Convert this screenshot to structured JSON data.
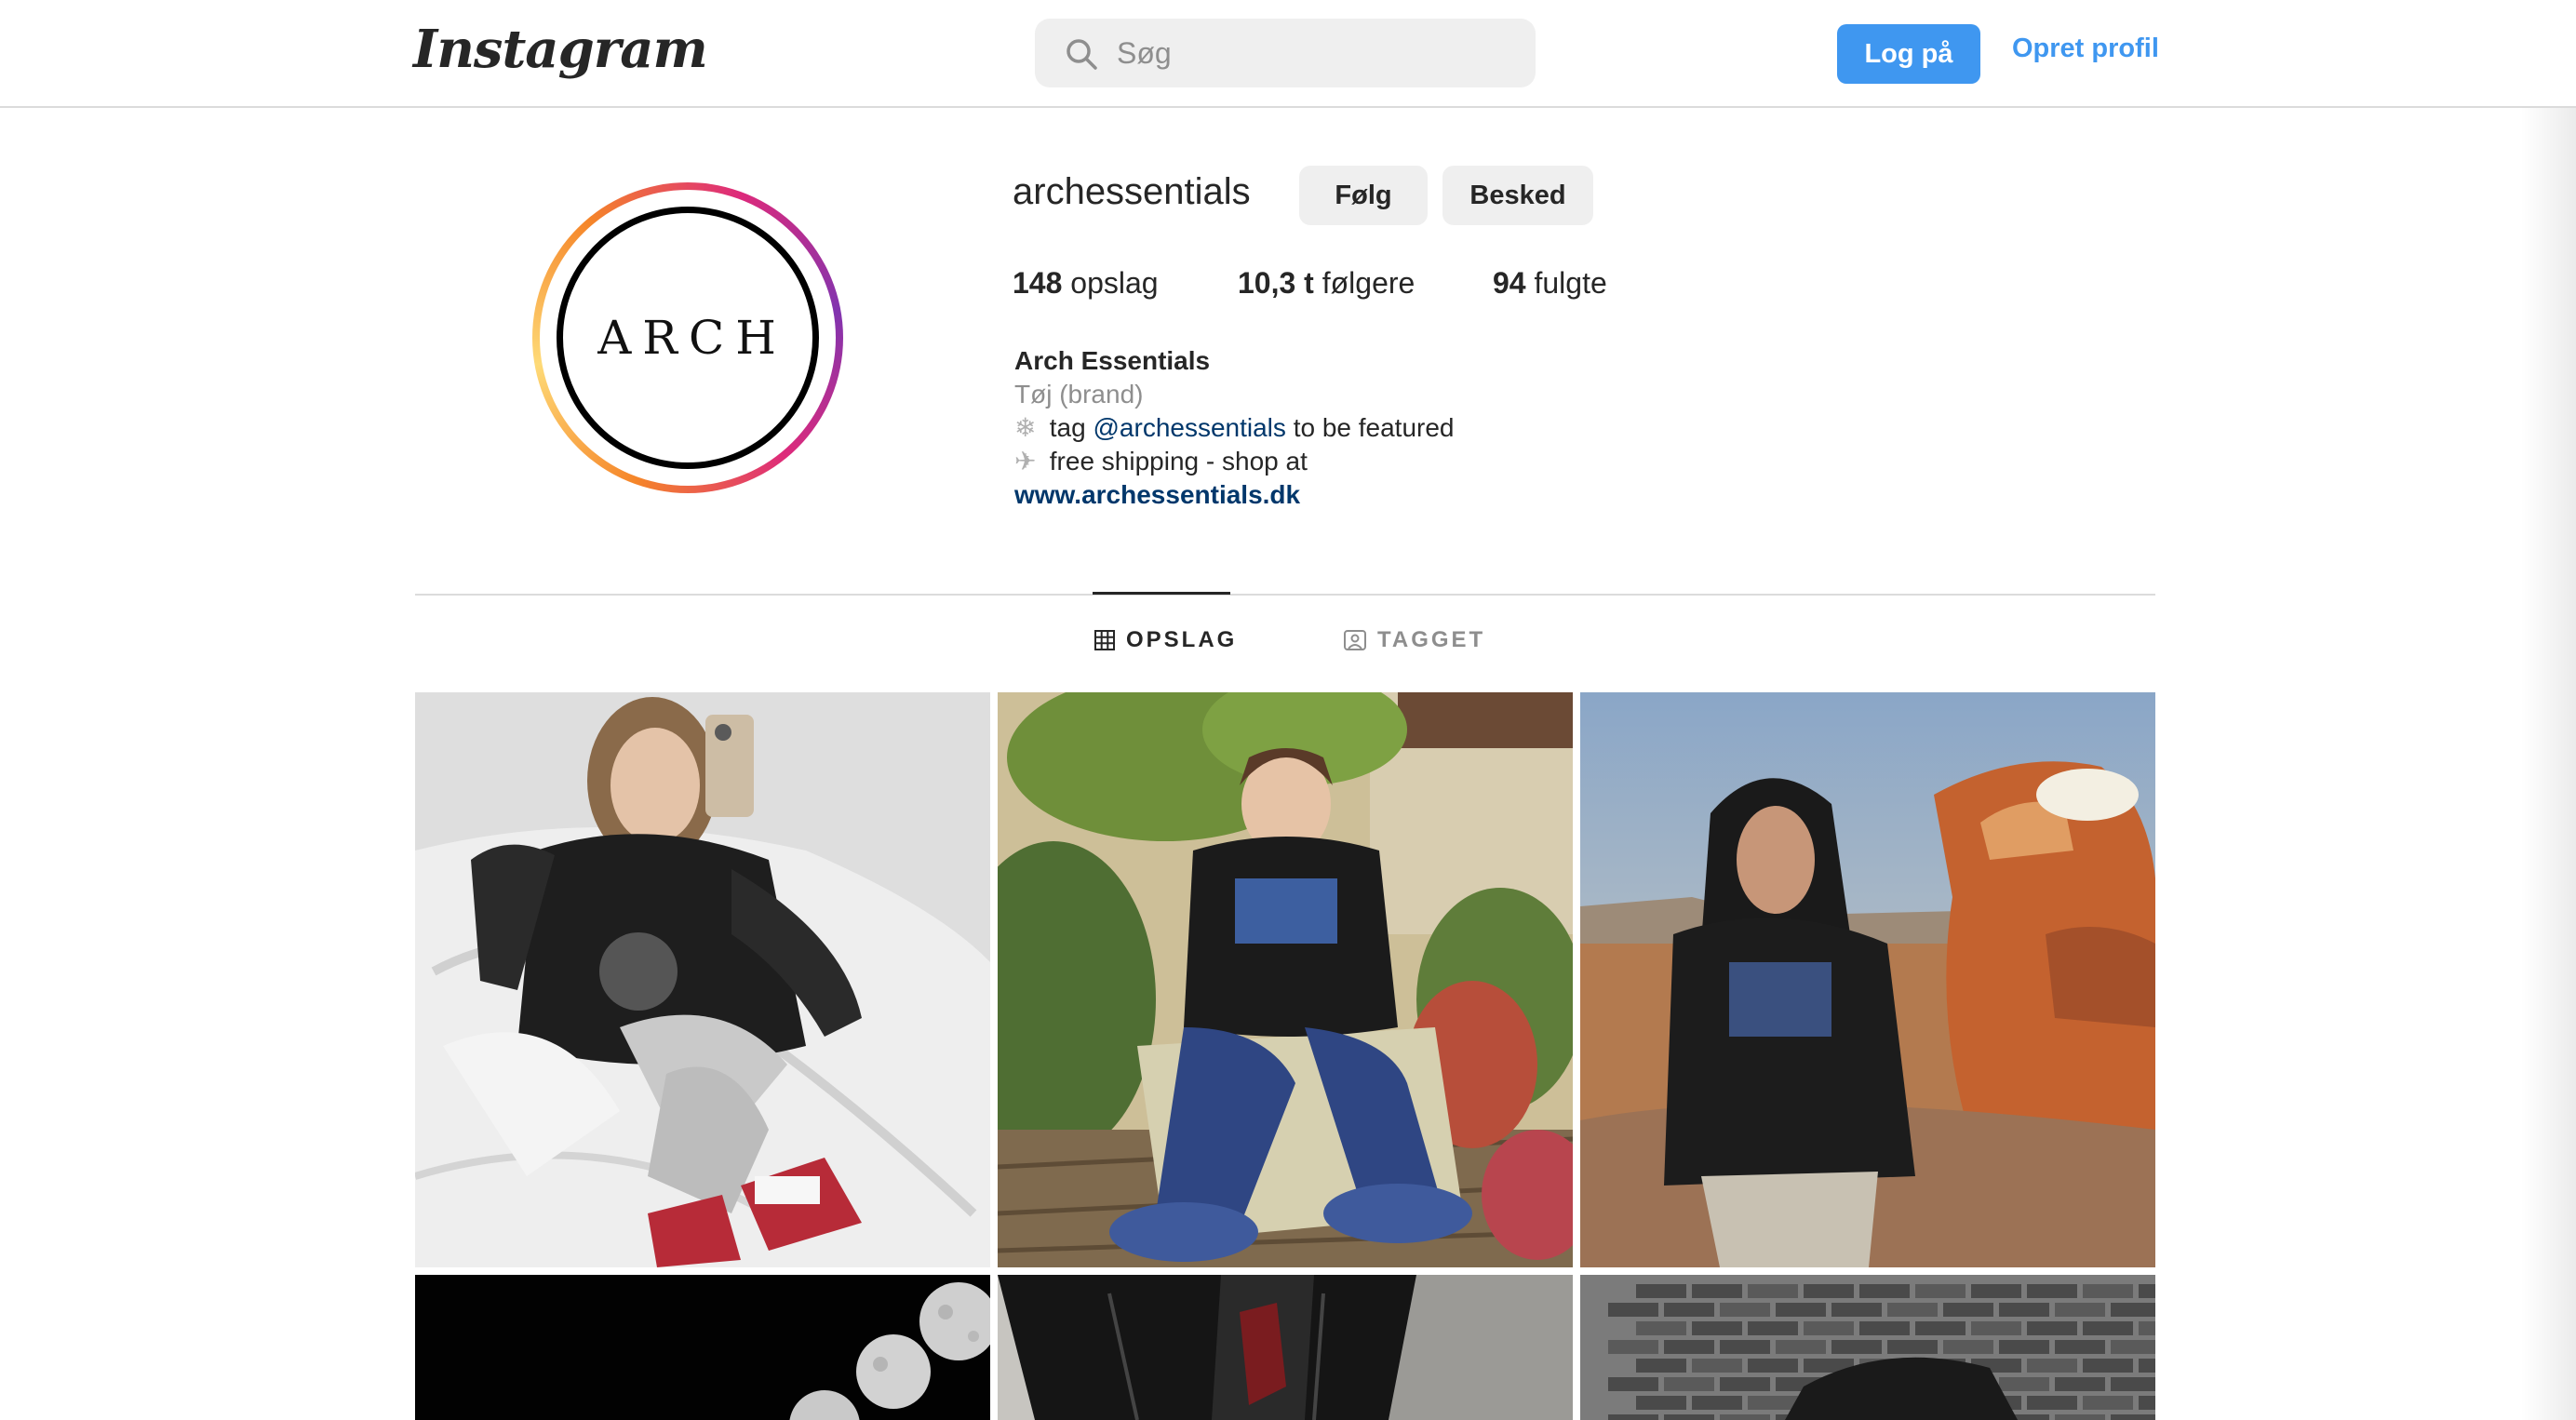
{
  "header": {
    "logo": "Instagram",
    "search_placeholder": "Søg",
    "login_label": "Log på",
    "signup_label": "Opret profil"
  },
  "profile": {
    "username": "archessentials",
    "avatar_text": "ARCH",
    "follow_label": "Følg",
    "message_label": "Besked",
    "stats": {
      "posts_count": "148",
      "posts_label": "opslag",
      "followers_count": "10,3 t",
      "followers_label": "følgere",
      "following_count": "94",
      "following_label": "fulgte"
    },
    "bio": {
      "name": "Arch Essentials",
      "category": "Tøj (brand)",
      "line1_pre": "tag",
      "line1_mention": "@archessentials",
      "line1_post": "to be featured",
      "line2": "free shipping - shop at",
      "url": "www.archessentials.dk"
    }
  },
  "tabs": [
    {
      "label": "OPSLAG",
      "icon": "grid-icon",
      "active": true
    },
    {
      "label": "TAGGET",
      "icon": "tagged-icon",
      "active": false
    }
  ],
  "colors": {
    "accent": "#3f97f0",
    "link": "#00376b",
    "secondary_text": "#8e8e8e",
    "border": "#dbdbdb"
  }
}
